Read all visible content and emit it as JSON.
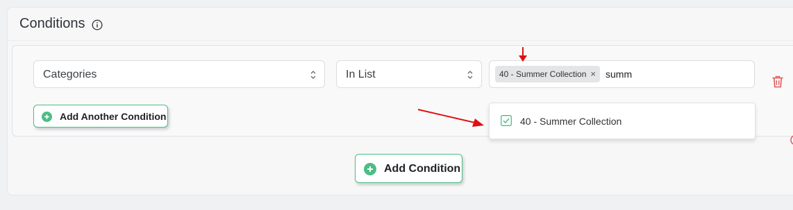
{
  "panel": {
    "title": "Conditions",
    "info_icon": "info-circle-icon"
  },
  "condition": {
    "field_select": {
      "value": "Categories"
    },
    "operator_select": {
      "value": "In List"
    },
    "values_input": {
      "tags": [
        "40 - Summer Collection"
      ],
      "typed_text": "summ"
    },
    "dropdown": {
      "options": [
        {
          "label": "40 - Summer Collection",
          "checked": true
        }
      ]
    },
    "delete_icon": "trash-icon",
    "add_another_label": "Add Another Condition"
  },
  "add_condition_label": "Add Condition",
  "colors": {
    "accent_green": "#4cbd85",
    "delete_red": "#e05a5a",
    "annotation_red": "#e01010"
  }
}
